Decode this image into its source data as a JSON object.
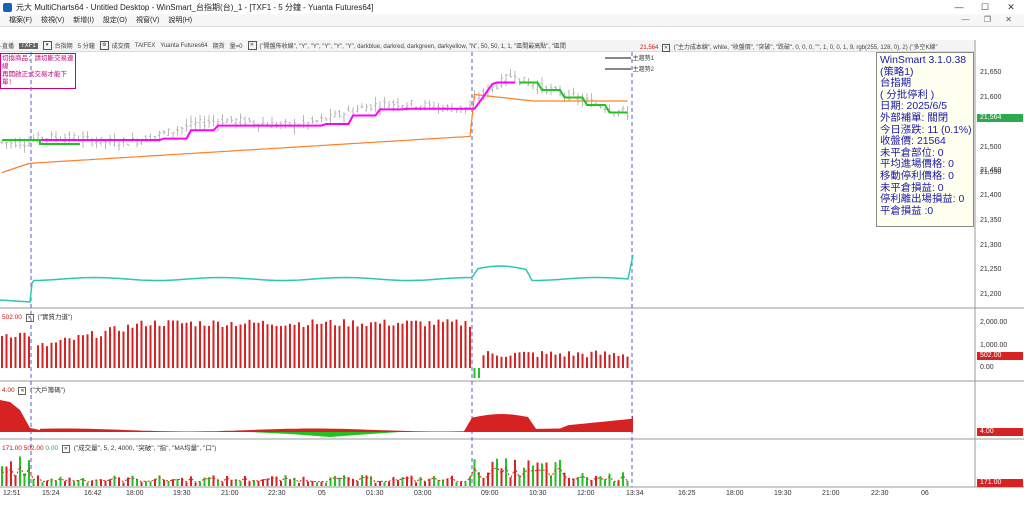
{
  "window": {
    "title": "元大 MultiCharts64 - Untitled Desktop - WinSmart_台指期(台)_1 - [TXF1 - 5 分鐘 - Yuanta Futures64]",
    "controls": [
      "—",
      "☐",
      "✕"
    ]
  },
  "menu": {
    "items": [
      "檔案(F)",
      "檢視(V)",
      "新增(I)",
      "設定(O)",
      "視窗(V)",
      "說明(H)"
    ],
    "right_controls": "— ❐ ✕"
  },
  "toolbar": {
    "items": [
      "-直播",
      "TXF1",
      "台指期",
      "5 分鐘",
      "成交價",
      "TAIFEX",
      "Yuanta Futures64",
      "期貨",
      "量=0"
    ],
    "indicator_text": "(\"開盤佈收線\", \"Y\", \"Y\", \"Y\", \"Y\", \"Y\", darkblue, darkred, darkgreen, darkyellow, \"N\", 50, 50, 1, 1, \"區間最高點\", \"區間",
    "right_value": "21,564",
    "right_text": "(\"主力成本線\", white, \"收盤價\", \"突破\", \"跌破\", 0, 0, 0, \"\", 1, 0, 0, 1, 9, rgb(255, 128, 0), 2)",
    "right_text2": "(\"多空K線\""
  },
  "alert_note": [
    "切換商品：請切斷交易連線",
    "再開啟正式交易才能下單！"
  ],
  "legend": {
    "line1": "主趨勢1",
    "line2": "主趨勢2"
  },
  "info_box": {
    "lines": [
      "WinSmart 3.1.0.38",
      "(策略1)",
      "台指期",
      "( 分批停利 )",
      "日期: 2025/6/5",
      "外部補單: 關閉",
      "今日漲跌: 11 (0.1%)",
      "收盤價: 21564",
      "未平倉部位: 0",
      "平均進場價格: 0",
      "移動停利價格: 0",
      "未平倉損益: 0",
      "停利離出場損益: 0",
      "平倉損益 :0"
    ]
  },
  "price_axis": {
    "labels": [
      "21,650",
      "21,600",
      "21,550",
      "21,500",
      "21,450",
      "21,400",
      "21,350",
      "21,300",
      "21,250",
      "21,200"
    ],
    "current": "21,564"
  },
  "pane2": {
    "value": "502.00",
    "title": "(\"實質力道\")",
    "axis": [
      "2,000.00",
      "1,000.00",
      "0.00"
    ],
    "tag": "502.00"
  },
  "pane3": {
    "value": "4.00",
    "title": "(\"大戶籌碼\")",
    "tag": "4.00"
  },
  "pane4": {
    "value1": "171.00",
    "value2": "502.00",
    "value3": "0.00",
    "title": "(\"成交量\", 5, 2, 4000, \"突破\", \"指\", \"MA均量\", \"口\")",
    "tag": "171.00"
  },
  "time_axis": [
    "12:51",
    "15:24",
    "16:42",
    "18:00",
    "19:30",
    "21:00",
    "22:30",
    "05",
    "01:30",
    "03:00",
    "09:00",
    "10:30",
    "12:00",
    "13:34",
    "16:25",
    "18:00",
    "19:30",
    "21:00",
    "22:30",
    "06"
  ],
  "colors": {
    "magenta": "#ff00ff",
    "orange": "#ff7f27",
    "green": "#22c222",
    "teal": "#2bc7b5",
    "red": "#d62222",
    "info_text": "#1a1aa8"
  }
}
